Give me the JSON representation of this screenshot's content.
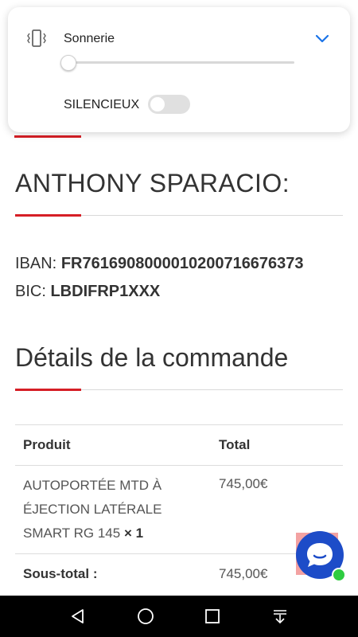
{
  "sound_panel": {
    "title": "Sonnerie",
    "silent_label": "SILENCIEUX",
    "volume_level": 0,
    "silent_enabled": false
  },
  "recipient": {
    "name": "ANTHONY SPARACIO:",
    "iban_label": "IBAN:",
    "iban_value": "FR7616908000010200716676373",
    "bic_label": "BIC:",
    "bic_value": "LBDIFRP1XXX"
  },
  "order": {
    "heading": "Détails de la commande",
    "col_product": "Produit",
    "col_total": "Total",
    "item_name_1": "AUTOPORTÉE MTD À",
    "item_name_2": "ÉJECTION LATÉRALE",
    "item_name_3": "SMART RG 145",
    "item_qty": "× 1",
    "item_total": "745,00€",
    "subtotal_label": "Sous-total :",
    "subtotal_value": "745,00€"
  },
  "colors": {
    "accent_red": "#d61f26",
    "chat_blue": "#1d4cc8",
    "online_green": "#2ecc40"
  },
  "icons": {
    "sound_mode": "vibrate-icon",
    "expand": "chevron-down-icon",
    "chat": "chat-bubble-icon",
    "nav_back": "back-triangle-icon",
    "nav_home": "home-circle-icon",
    "nav_recent": "recent-apps-square-icon",
    "nav_notifications": "pull-down-icon"
  }
}
